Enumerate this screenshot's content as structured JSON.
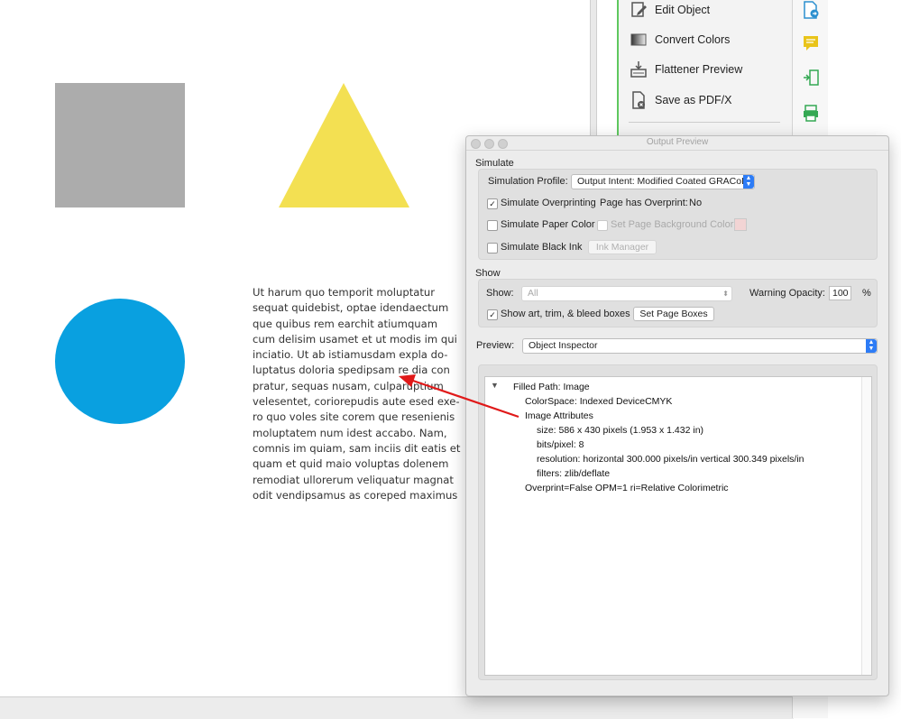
{
  "document": {
    "paragraph_lines": [
      "Ut harum quo temporit moluptatur",
      "sequat quidebist, optae idendaectum",
      "que quibus rem earchit atiumquam",
      "cum delisim usamet et ut modis im qui",
      "inciatio. Ut ab istiamusdam expla do-",
      "luptatus doloria spedipsam re dia con",
      "pratur, sequas nusam, culparuptium",
      "velesentet, coriorepudis aute esed exe-",
      "ro quo voles site corem que resenienis",
      "moluptatem num idest accabo. Nam,",
      "comnis im quiam, sam inciis dit eatis et",
      "quam et quid maio voluptas dolenem",
      "remodiat ullorerum veliquatur magnat",
      "odit vendipsamus as coreped maximus"
    ],
    "shape_colors": {
      "square": "#acacac",
      "triangle": "#f3e052",
      "circle": "#09a0e0"
    }
  },
  "tools_panel": {
    "items": [
      {
        "label": "Edit Object",
        "icon": "edit-object-icon"
      },
      {
        "label": "Convert Colors",
        "icon": "convert-colors-icon"
      },
      {
        "label": "Flattener Preview",
        "icon": "flattener-preview-icon"
      },
      {
        "label": "Save as PDF/X",
        "icon": "save-pdfx-icon"
      }
    ],
    "side_icons": [
      "export-pdf-icon",
      "comment-icon",
      "organize-pages-icon",
      "print-production-icon"
    ]
  },
  "dialog": {
    "title": "Output Preview",
    "simulate": {
      "heading": "Simulate",
      "profile_label": "Simulation Profile:",
      "profile_value": "Output Intent: Modified Coated GRACoL...",
      "overprinting_label": "Simulate Overprinting",
      "overprinting_checked": "✓",
      "page_overprint_label": "Page has Overprint:",
      "page_overprint_value": "No",
      "paper_color_label": "Simulate Paper Color",
      "page_bg_label": "Set Page Background Color",
      "black_ink_label": "Simulate Black Ink",
      "ink_manager_label": "Ink Manager"
    },
    "show": {
      "heading": "Show",
      "show_label": "Show:",
      "show_value": "All",
      "warning_opacity_label": "Warning Opacity:",
      "warning_opacity_value": "100",
      "percent": "%",
      "boxes_label": "Show art, trim, & bleed boxes",
      "boxes_checked": "✓",
      "set_page_boxes_label": "Set Page Boxes"
    },
    "preview": {
      "label": "Preview:",
      "value": "Object Inspector"
    },
    "inspector": {
      "lines": [
        {
          "text": "Filled Path: Image"
        },
        {
          "text": "ColorSpace: Indexed DeviceCMYK"
        },
        {
          "text": "Image Attributes"
        },
        {
          "text": "size: 586 x 430 pixels (1.953 x 1.432 in)"
        },
        {
          "text": "bits/pixel: 8"
        },
        {
          "text": "resolution: horizontal 300.000 pixels/in vertical 300.349 pixels/in"
        },
        {
          "text": "filters: zlib/deflate"
        },
        {
          "text": "Overprint=False OPM=1 ri=Relative Colorimetric"
        }
      ]
    }
  },
  "annotation_arrow_color": "#e01919"
}
